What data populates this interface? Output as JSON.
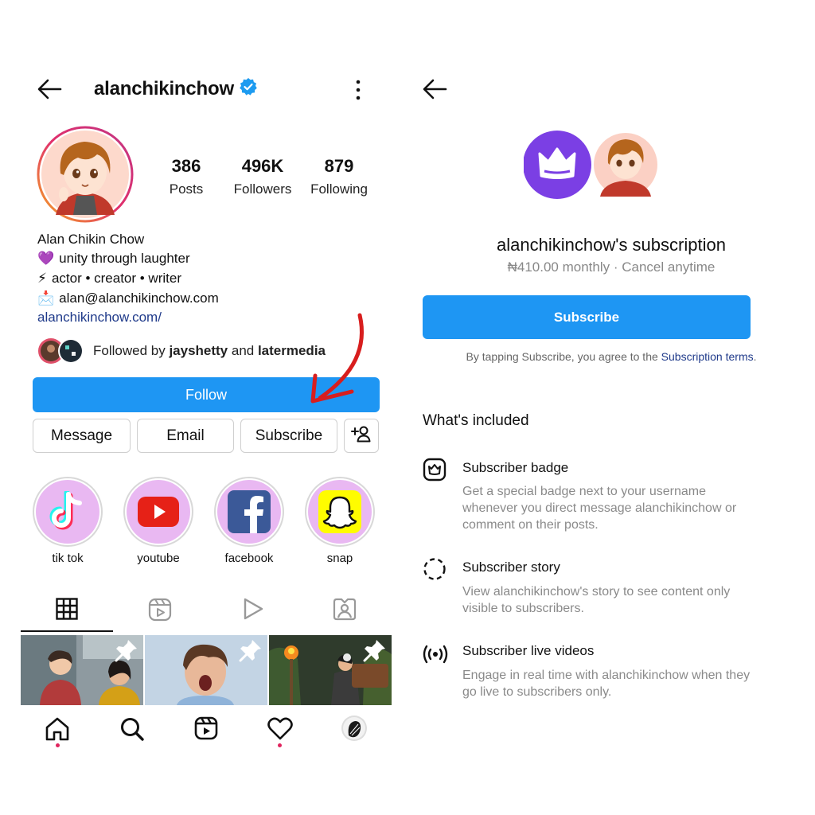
{
  "profile": {
    "username": "alanchikinchow",
    "verified_icon": "verified-badge-icon",
    "menu_icon": "more-vertical-icon",
    "stats": [
      {
        "value": "386",
        "label": "Posts"
      },
      {
        "value": "496K",
        "label": "Followers"
      },
      {
        "value": "879",
        "label": "Following"
      }
    ],
    "name": "Alan Chikin Chow",
    "bio": [
      {
        "emoji": "💜",
        "text": "unity through laughter"
      },
      {
        "emoji": "⚡",
        "text": "actor • creator • writer"
      },
      {
        "emoji": "📩",
        "text": "alan@alanchikinchow.com"
      }
    ],
    "link": "alanchikinchow.com/",
    "followed_by_prefix": "Followed by ",
    "followed_by_user1": "jayshetty",
    "followed_by_and": " and ",
    "followed_by_user2": "latermedia"
  },
  "actions": {
    "follow": "Follow",
    "message": "Message",
    "email": "Email",
    "subscribe": "Subscribe"
  },
  "highlights": [
    {
      "label": "tik tok",
      "icon": "tiktok-icon"
    },
    {
      "label": "youtube",
      "icon": "youtube-icon"
    },
    {
      "label": "facebook",
      "icon": "facebook-icon"
    },
    {
      "label": "snap",
      "icon": "snapchat-icon"
    }
  ],
  "tabs": [
    "grid-icon",
    "reels-icon",
    "play-icon",
    "tagged-icon"
  ],
  "bottom_nav": [
    "home-icon",
    "search-icon",
    "reels-icon",
    "heart-icon",
    "profile-avatar"
  ],
  "subscription": {
    "title": "alanchikinchow's subscription",
    "price": "₦410.00 monthly · Cancel anytime",
    "subscribe_button": "Subscribe",
    "terms_prefix": "By tapping Subscribe, you agree to the ",
    "terms_link": "Subscription terms",
    "terms_suffix": ".",
    "included_title": "What's included",
    "features": [
      {
        "icon": "crown-badge-icon",
        "title": "Subscriber badge",
        "description": "Get a special badge next to your username whenever you direct message alanchikinchow or comment on their posts."
      },
      {
        "icon": "dashed-circle-icon",
        "title": "Subscriber story",
        "description": "View alanchikinchow's story to see content only visible to subscribers."
      },
      {
        "icon": "live-broadcast-icon",
        "title": "Subscriber live videos",
        "description": "Engage in real time with alanchikinchow when they go live to subscribers only."
      }
    ]
  },
  "colors": {
    "primary_blue": "#1e96f3",
    "verified_blue": "#1d9bf0",
    "crown_purple": "#7b3fe4",
    "annotation_red": "#d81e1e",
    "highlight_bg": "#e9b8f2"
  }
}
